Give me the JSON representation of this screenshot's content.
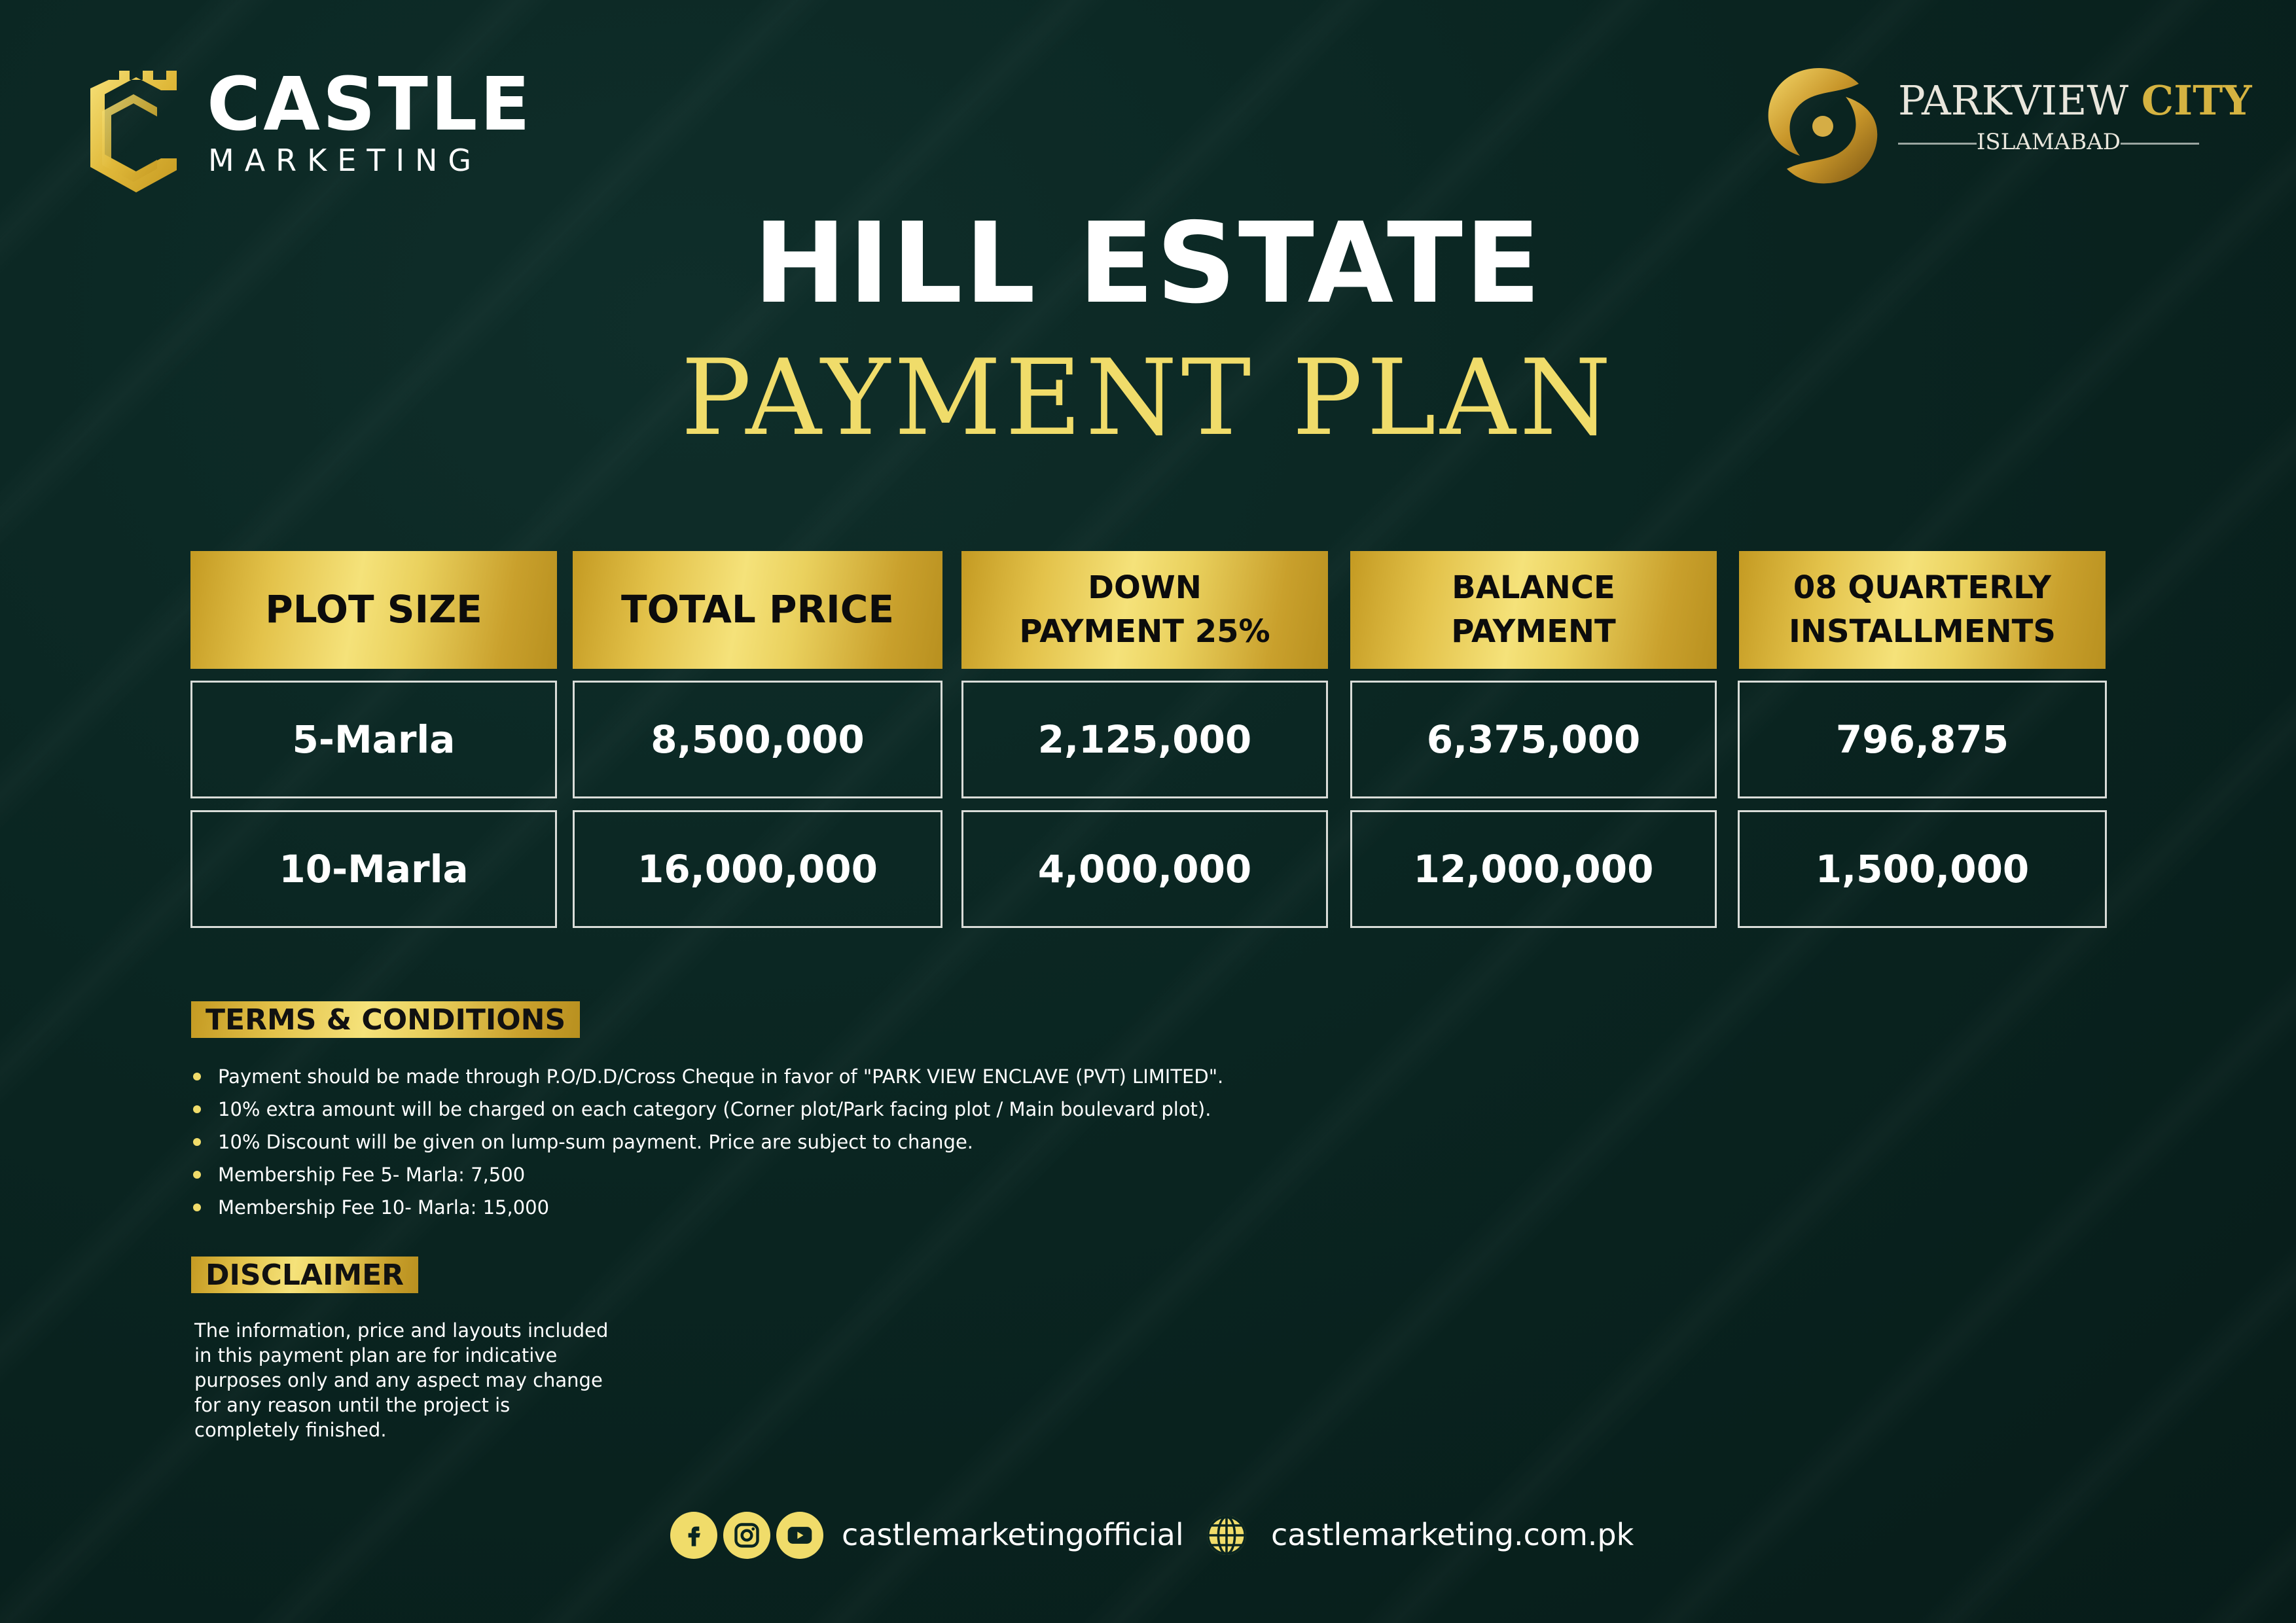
{
  "colors": {
    "background": "#0a2521",
    "gold": "#e3c24a",
    "title_gold": "#f0dc6a",
    "text": "#ffffff"
  },
  "brand": {
    "castle_name": "CASTLE",
    "castle_sub": "MARKETING"
  },
  "partner": {
    "name_part1": "PARKVIEW",
    "name_part2": "CITY",
    "city": "ISLAMABAD"
  },
  "title": "HILL ESTATE",
  "subtitle": "PAYMENT PLAN",
  "table": {
    "headers": [
      "PLOT SIZE",
      "TOTAL PRICE",
      "DOWN\nPAYMENT 25%",
      "BALANCE\nPAYMENT",
      "08 QUARTERLY\nINSTALLMENTS"
    ],
    "rows": [
      [
        "5-Marla",
        "8,500,000",
        "2,125,000",
        "6,375,000",
        "796,875"
      ],
      [
        "10-Marla",
        "16,000,000",
        "4,000,000",
        "12,000,000",
        "1,500,000"
      ]
    ]
  },
  "terms": {
    "heading": "TERMS & CONDITIONS",
    "items": [
      "Payment should be made through P.O/D.D/Cross Cheque in favor of \"PARK VIEW ENCLAVE (PVT) LIMITED\".",
      "10% extra amount will be charged on each category (Corner plot/Park facing plot / Main boulevard plot).",
      "10% Discount will be given on lump-sum payment. Price are subject to change.",
      "Membership Fee 5- Marla: 7,500",
      "Membership Fee 10- Marla: 15,000"
    ]
  },
  "disclaimer": {
    "heading": "DISCLAIMER",
    "text": "The information, price and layouts included in this payment plan are for indicative purposes only and any aspect may change for any reason until the project is completely finished."
  },
  "footer": {
    "social_icons": [
      "facebook-icon",
      "instagram-icon",
      "youtube-icon"
    ],
    "social_handle": "castlemarketingofficial",
    "web_icon": "globe-icon",
    "website": "castlemarketing.com.pk"
  }
}
